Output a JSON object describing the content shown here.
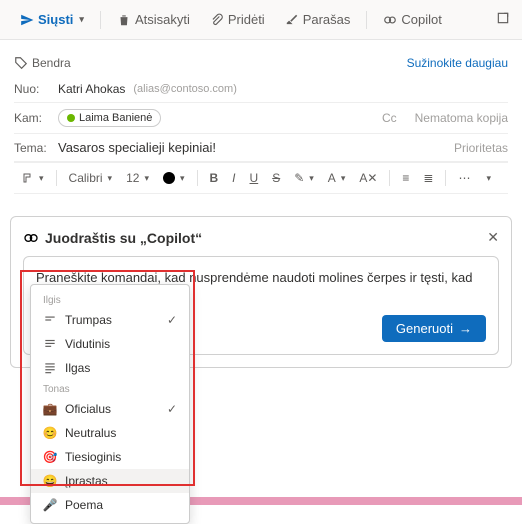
{
  "toolbar": {
    "send": "Siųsti",
    "discard": "Atsisakyti",
    "attach": "Pridėti",
    "signature": "Parašas",
    "copilot": "Copilot"
  },
  "tag_label": "Bendra",
  "learn_more": "Sužinokite daugiau",
  "fields": {
    "from_label": "Nuo:",
    "from_name": "Katri Ahokas",
    "from_alias": "(alias@contoso.com)",
    "to_label": "Kam:",
    "to_name": "Laima Banienė",
    "cc": "Cc",
    "bcc": "Nematoma kopija",
    "subject_label": "Tema:",
    "subject": "Vasaros specialieji kepiniai!",
    "priority": "Prioritetas"
  },
  "format": {
    "font": "Calibri",
    "size": "12",
    "bold": "B",
    "italic": "I",
    "underline": "U",
    "strike": "S"
  },
  "copilot": {
    "title": "Juodraštis su „Copilot“",
    "prompt": "Praneškite komandai, kad nusprendėme naudoti molines čerpes ir tęsti, kad pasiektume terminą",
    "generate": "Generuoti"
  },
  "dropdown": {
    "section1": "Ilgis",
    "items1": [
      {
        "label": "Trumpas",
        "check": true
      },
      {
        "label": "Vidutinis",
        "check": false
      },
      {
        "label": "Ilgas",
        "check": false
      }
    ],
    "section2": "Tonas",
    "items2": [
      {
        "label": "Oficialus",
        "icon": "💼",
        "check": true
      },
      {
        "label": "Neutralus",
        "icon": "😊",
        "check": false
      },
      {
        "label": "Tiesioginis",
        "icon": "🎯",
        "check": false
      },
      {
        "label": "Įprastas",
        "icon": "😄",
        "check": false,
        "hover": true
      },
      {
        "label": "Poema",
        "icon": "🎤",
        "check": false
      }
    ]
  }
}
